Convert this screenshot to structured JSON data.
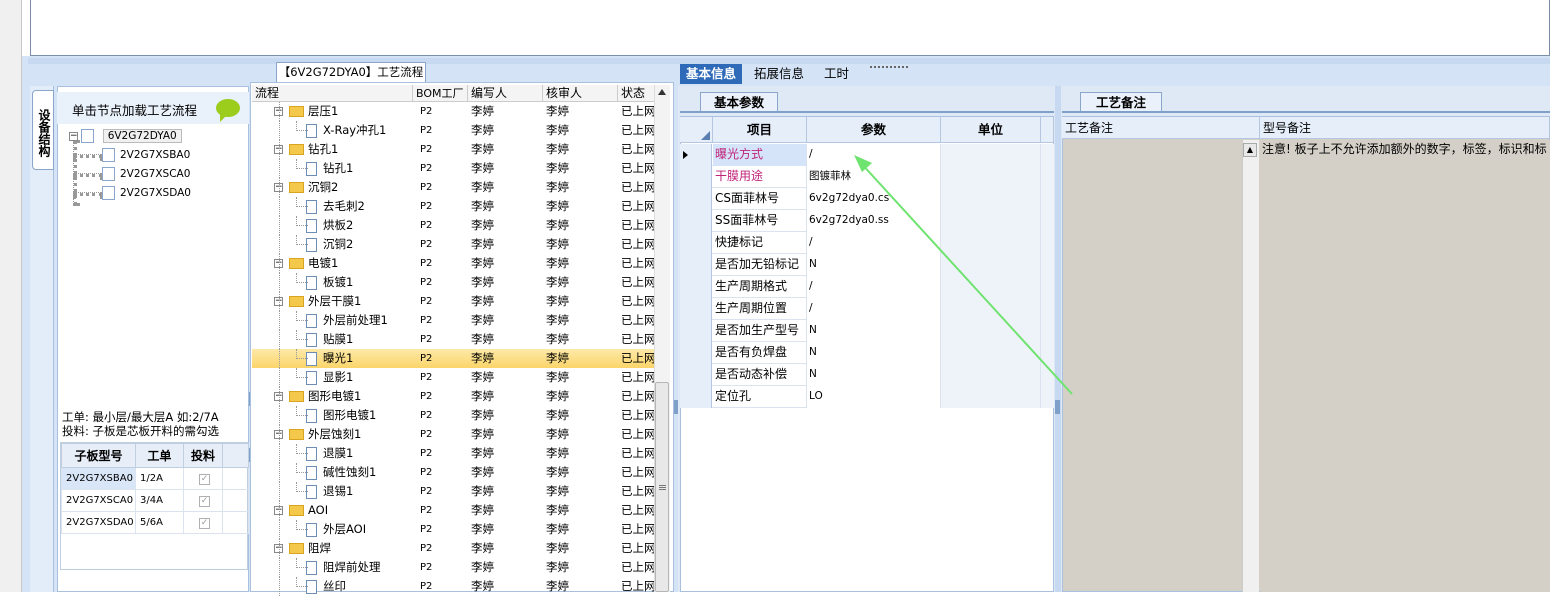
{
  "colors": {
    "accent": "#2e6ab8",
    "selection": "#fbd56a",
    "pink_label": "#c0237a",
    "annotation_arrow": "#6fe36f"
  },
  "left_panel": {
    "vertical_tab": "设备结构",
    "header_text": "单击节点加载工艺流程",
    "tree": {
      "root": "6V2G72DYA0",
      "children": [
        "2V2G7XSBA0",
        "2V2G7XSCA0",
        "2V2G7XSDA0"
      ]
    },
    "note_line1": "工单: 最小层/最大层A 如:2/7A",
    "note_line2": "投料: 子板是芯板开料的需勾选",
    "grid": {
      "headers": [
        "子板型号",
        "工单",
        "投料"
      ],
      "rows": [
        {
          "model": "2V2G7XSBA0",
          "order": "1/2A",
          "checked": true
        },
        {
          "model": "2V2G7XSCA0",
          "order": "3/4A",
          "checked": true
        },
        {
          "model": "2V2G7XSDA0",
          "order": "5/6A",
          "checked": true
        }
      ]
    }
  },
  "process_panel": {
    "tab_label": "【6V2G72DYA0】工艺流程",
    "headers": [
      "流程",
      "BOM工厂",
      "编写人",
      "核审人",
      "状态"
    ],
    "rows": [
      {
        "name": "层压1",
        "level": 0,
        "factory": "P2",
        "writer": "李婷",
        "reviewer": "李婷",
        "status": "已上网"
      },
      {
        "name": "X-Ray冲孔1",
        "level": 1,
        "factory": "P2",
        "writer": "李婷",
        "reviewer": "李婷",
        "status": "已上网"
      },
      {
        "name": "钻孔1",
        "level": 0,
        "factory": "P2",
        "writer": "李婷",
        "reviewer": "李婷",
        "status": "已上网"
      },
      {
        "name": "钻孔1",
        "level": 1,
        "factory": "P2",
        "writer": "李婷",
        "reviewer": "李婷",
        "status": "已上网"
      },
      {
        "name": "沉铜2",
        "level": 0,
        "factory": "P2",
        "writer": "李婷",
        "reviewer": "李婷",
        "status": "已上网"
      },
      {
        "name": "去毛刺2",
        "level": 1,
        "factory": "P2",
        "writer": "李婷",
        "reviewer": "李婷",
        "status": "已上网"
      },
      {
        "name": "烘板2",
        "level": 1,
        "factory": "P2",
        "writer": "李婷",
        "reviewer": "李婷",
        "status": "已上网"
      },
      {
        "name": "沉铜2",
        "level": 1,
        "factory": "P2",
        "writer": "李婷",
        "reviewer": "李婷",
        "status": "已上网"
      },
      {
        "name": "电镀1",
        "level": 0,
        "factory": "P2",
        "writer": "李婷",
        "reviewer": "李婷",
        "status": "已上网"
      },
      {
        "name": "板镀1",
        "level": 1,
        "factory": "P2",
        "writer": "李婷",
        "reviewer": "李婷",
        "status": "已上网"
      },
      {
        "name": "外层干膜1",
        "level": 0,
        "factory": "P2",
        "writer": "李婷",
        "reviewer": "李婷",
        "status": "已上网"
      },
      {
        "name": "外层前处理1",
        "level": 1,
        "factory": "P2",
        "writer": "李婷",
        "reviewer": "李婷",
        "status": "已上网"
      },
      {
        "name": "贴膜1",
        "level": 1,
        "factory": "P2",
        "writer": "李婷",
        "reviewer": "李婷",
        "status": "已上网"
      },
      {
        "name": "曝光1",
        "level": 1,
        "factory": "P2",
        "writer": "李婷",
        "reviewer": "李婷",
        "status": "已上网",
        "selected": true
      },
      {
        "name": "显影1",
        "level": 1,
        "factory": "P2",
        "writer": "李婷",
        "reviewer": "李婷",
        "status": "已上网"
      },
      {
        "name": "图形电镀1",
        "level": 0,
        "factory": "P2",
        "writer": "李婷",
        "reviewer": "李婷",
        "status": "已上网"
      },
      {
        "name": "图形电镀1",
        "level": 1,
        "factory": "P2",
        "writer": "李婷",
        "reviewer": "李婷",
        "status": "已上网"
      },
      {
        "name": "外层蚀刻1",
        "level": 0,
        "factory": "P2",
        "writer": "李婷",
        "reviewer": "李婷",
        "status": "已上网"
      },
      {
        "name": "退膜1",
        "level": 1,
        "factory": "P2",
        "writer": "李婷",
        "reviewer": "李婷",
        "status": "已上网"
      },
      {
        "name": "碱性蚀刻1",
        "level": 1,
        "factory": "P2",
        "writer": "李婷",
        "reviewer": "李婷",
        "status": "已上网"
      },
      {
        "name": "退锡1",
        "level": 1,
        "factory": "P2",
        "writer": "李婷",
        "reviewer": "李婷",
        "status": "已上网"
      },
      {
        "name": "AOI",
        "level": 0,
        "factory": "P2",
        "writer": "李婷",
        "reviewer": "李婷",
        "status": "已上网"
      },
      {
        "name": "外层AOI",
        "level": 1,
        "factory": "P2",
        "writer": "李婷",
        "reviewer": "李婷",
        "status": "已上网"
      },
      {
        "name": "阻焊",
        "level": 0,
        "factory": "P2",
        "writer": "李婷",
        "reviewer": "李婷",
        "status": "已上网"
      },
      {
        "name": "阻焊前处理",
        "level": 1,
        "factory": "P2",
        "writer": "李婷",
        "reviewer": "李婷",
        "status": "已上网"
      },
      {
        "name": "丝印",
        "level": 1,
        "factory": "P2",
        "writer": "李婷",
        "reviewer": "李婷",
        "status": "已上网"
      }
    ]
  },
  "right_panel": {
    "tabs": [
      "基本信息",
      "拓展信息",
      "工时"
    ],
    "subtab_basic": "基本参数",
    "subtab_notes": "工艺备注",
    "param_headers": [
      "项目",
      "参数",
      "单位"
    ],
    "params": [
      {
        "key": "曝光方式",
        "value": "/",
        "pink": true,
        "current": true
      },
      {
        "key": "干膜用途",
        "value": "图镀菲林",
        "pink": true
      },
      {
        "key": "CS面菲林号",
        "value": "6v2g72dya0.cs"
      },
      {
        "key": "SS面菲林号",
        "value": "6v2g72dya0.ss"
      },
      {
        "key": "快捷标记",
        "value": "/"
      },
      {
        "key": "是否加无铅标记",
        "value": "N"
      },
      {
        "key": "生产周期格式",
        "value": "/"
      },
      {
        "key": "生产周期位置",
        "value": "/"
      },
      {
        "key": "是否加生产型号",
        "value": "N"
      },
      {
        "key": "是否有负焊盘",
        "value": "N"
      },
      {
        "key": "是否动态补偿",
        "value": "N"
      },
      {
        "key": "定位孔",
        "value": "LO"
      }
    ],
    "notes_headers": [
      "工艺备注",
      "型号备注"
    ],
    "model_note": "注意! 板子上不允许添加额外的数字，标签，标识和标"
  }
}
